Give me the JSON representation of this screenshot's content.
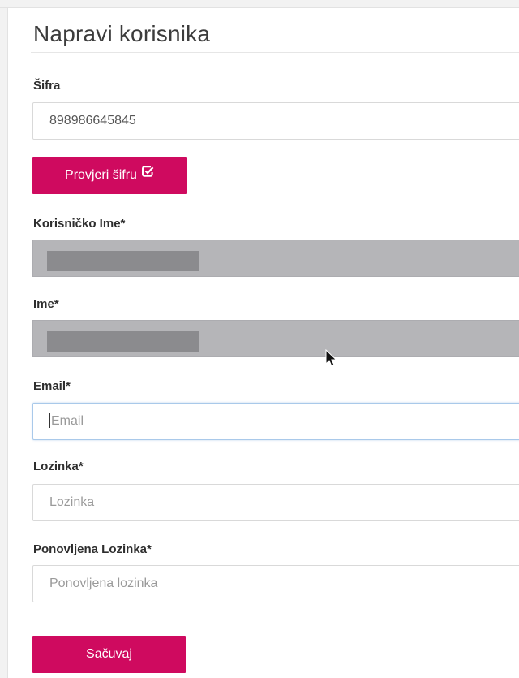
{
  "page": {
    "title": "Napravi korisnika"
  },
  "form": {
    "code": {
      "label": "Šifra",
      "value": "898986645845"
    },
    "check_button": {
      "label": "Provjeri šifru",
      "icon": "check-square-icon"
    },
    "username": {
      "label": "Korisničko Ime*",
      "state": "disabled-redacted"
    },
    "name": {
      "label": "Ime*",
      "state": "disabled-redacted"
    },
    "email": {
      "label": "Email*",
      "placeholder": "Email",
      "focused": true
    },
    "password": {
      "label": "Lozinka*",
      "placeholder": "Lozinka"
    },
    "password_repeat": {
      "label": "Ponovljena Lozinka*",
      "placeholder": "Ponovljena lozinka"
    },
    "save_button": {
      "label": "Sačuvaj"
    }
  },
  "colors": {
    "accent": "#cf0a5f",
    "disabled_field": "#b5b5b8",
    "redaction": "#8b8b8e"
  },
  "pointer": {
    "icon": "mouse-pointer-icon"
  }
}
